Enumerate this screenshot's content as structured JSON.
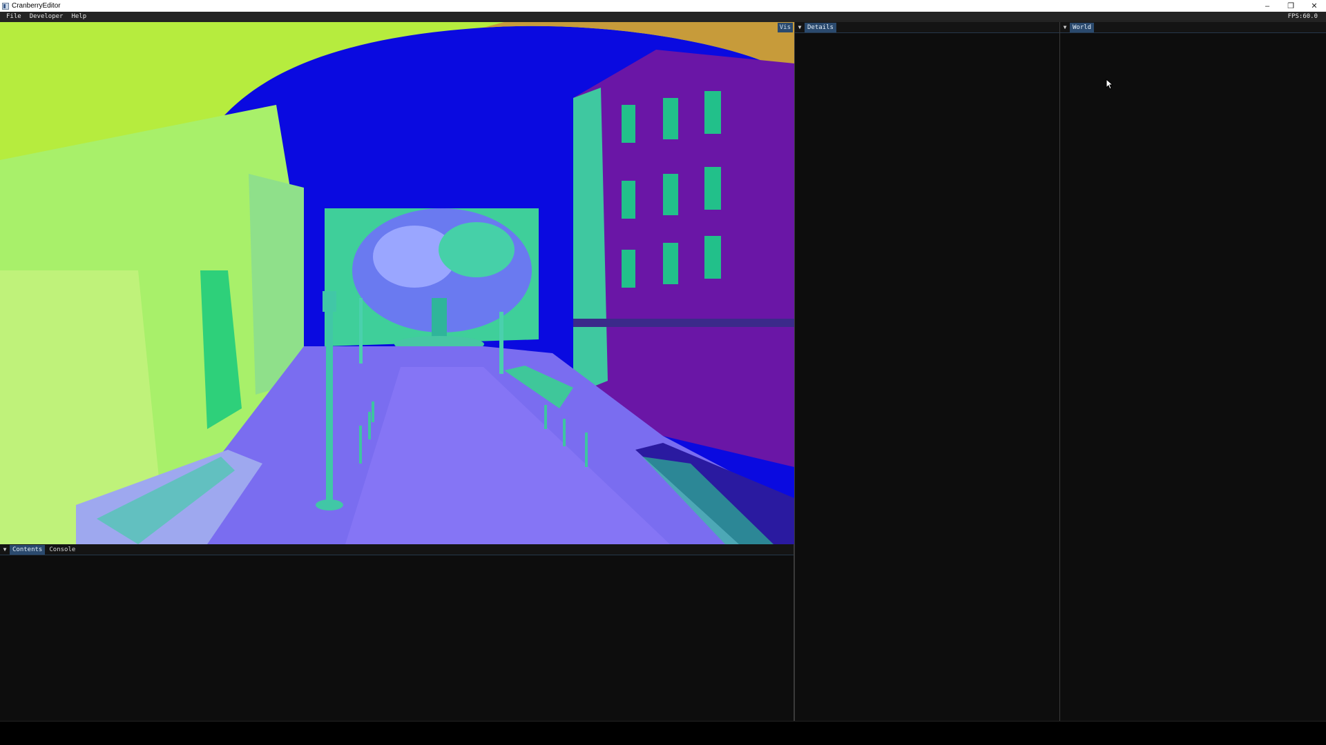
{
  "window": {
    "title": "CranberryEditor",
    "minimize_icon": "minimize-icon",
    "restore_icon": "restore-icon",
    "close_icon": "close-icon"
  },
  "menubar": {
    "items": [
      "File",
      "Developer",
      "Help"
    ],
    "fps": "FPS:60.0"
  },
  "viewport": {
    "vis_tab": "Vis",
    "sky_color": "#0a0ae0"
  },
  "bottom_panel": {
    "tabs": [
      {
        "label": "Contents",
        "active": true
      },
      {
        "label": "Console",
        "active": false
      }
    ]
  },
  "details_panel": {
    "tab": "Details"
  },
  "world_panel": {
    "tab": "World"
  }
}
